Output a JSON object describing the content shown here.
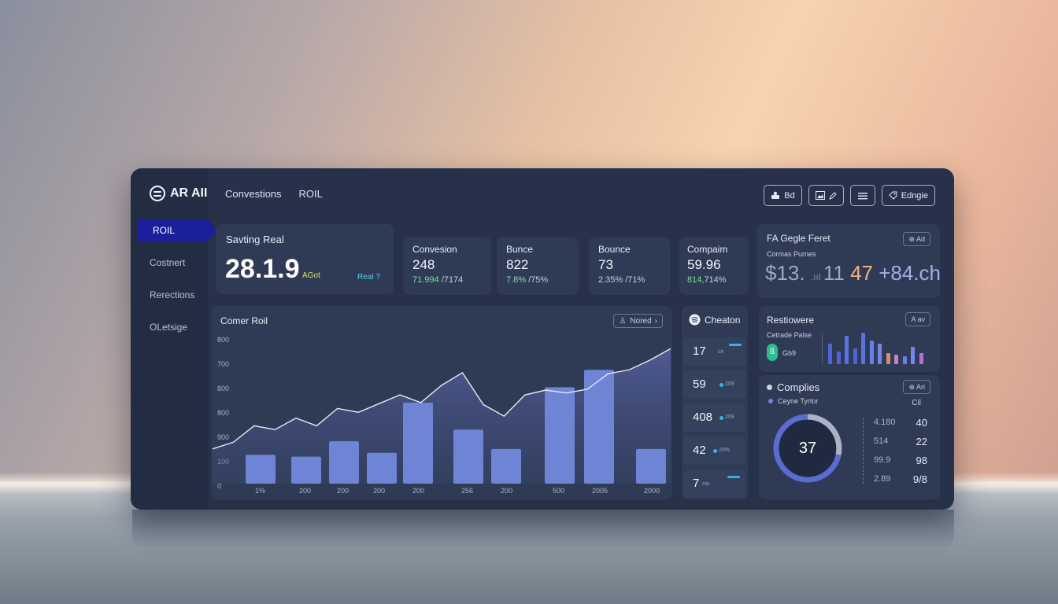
{
  "brand": "AR AII",
  "nav": {
    "tabs": [
      "Convestions",
      "ROIL"
    ]
  },
  "sidebar": {
    "items": [
      "ROIL",
      "Costnert",
      "Rerections",
      "OLetsige"
    ]
  },
  "toolbar": {
    "btn1": "Bd",
    "btn4": "Edngie"
  },
  "hero": {
    "title": "Savting Real",
    "value": "28.1.9",
    "tag": "AGot",
    "link": "Real ?"
  },
  "stats": [
    {
      "label": "Convesion",
      "value": "248",
      "sub_green": "71.994",
      "sub_rest": " /7174"
    },
    {
      "label": "Bunce",
      "value": "822",
      "sub_green": "7.8%",
      "sub_rest": " /75%"
    },
    {
      "label": "Bounce",
      "value": "73",
      "sub_green": "",
      "sub_rest": "2.35% /71%"
    },
    {
      "label": "Compaim",
      "value": "59.96",
      "sub_green": "814,",
      "sub_rest": "714%"
    }
  ],
  "promo": {
    "title": "FA Gegle Feret",
    "chip": "⊕ Ad",
    "sub": "Cormas Purnes",
    "v1": "$13. ",
    "v2": "11",
    "v3": "47",
    "v4": "+84.ch"
  },
  "main_chart": {
    "title": "Comer Roil",
    "filter": "Nored",
    "y_ticks": [
      "800",
      "700",
      "800",
      "800",
      "900",
      "100",
      "0"
    ],
    "x_ticks": [
      "1%",
      "200",
      "200",
      "200",
      "200",
      "256",
      "200",
      "500",
      "2005",
      "2000"
    ]
  },
  "chart_data": {
    "type": "bar",
    "title": "Comer Roil",
    "bars": [
      300,
      280,
      440,
      320,
      840,
      560,
      360,
      1000,
      1180,
      360
    ],
    "line": [
      360,
      430,
      600,
      560,
      680,
      600,
      780,
      740,
      830,
      920,
      840,
      1020,
      1150,
      820,
      700,
      920,
      970,
      940,
      980,
      1140,
      1180,
      1280,
      1400
    ],
    "ylim": [
      0,
      1500
    ],
    "grid": false
  },
  "cheaton": {
    "title": "Cheaton",
    "items": [
      {
        "value": "17",
        "tag": "cir"
      },
      {
        "value": "59",
        "tag": "209"
      },
      {
        "value": "408",
        "tag": "209"
      },
      {
        "value": "42",
        "tag": "20%"
      },
      {
        "value": "7",
        "tag": "cia"
      }
    ]
  },
  "resolver": {
    "title": "Restiowere",
    "chip": "A av",
    "sub": "Cetrade Palse",
    "badge": "ß",
    "badge_text": "Gb9",
    "bars": [
      {
        "h": 26,
        "c": "#4f63d6"
      },
      {
        "h": 16,
        "c": "#4f63d6"
      },
      {
        "h": 36,
        "c": "#5b72e0"
      },
      {
        "h": 20,
        "c": "#4f63d6"
      },
      {
        "h": 40,
        "c": "#5b72e0"
      },
      {
        "h": 30,
        "c": "#6b7ee6"
      },
      {
        "h": 26,
        "c": "#7586ea"
      },
      {
        "h": 14,
        "c": "#d98b6f"
      },
      {
        "h": 12,
        "c": "#c882c4"
      },
      {
        "h": 10,
        "c": "#6b7ee6"
      },
      {
        "h": 22,
        "c": "#7586ea"
      },
      {
        "h": 14,
        "c": "#b870d0"
      }
    ]
  },
  "complies": {
    "title": "Complies",
    "chip": "⊕ Ari",
    "legend": "Ceyne Tyrtor",
    "col": "Cil",
    "center": "37",
    "rows": [
      {
        "label": "4.180",
        "value": "40"
      },
      {
        "label": "514",
        "value": "22"
      },
      {
        "label": "99.9",
        "value": "98"
      },
      {
        "label": "2.89",
        "value": "9/8"
      }
    ]
  }
}
